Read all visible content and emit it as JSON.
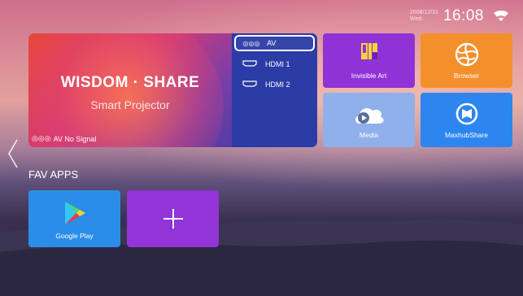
{
  "status": {
    "date": "2008/12/31",
    "weekday": "Wed.",
    "time": "16:08"
  },
  "hero": {
    "title": "WISDOM · SHARE",
    "subtitle": "Smart Projector",
    "signal_text": "AV No Signal"
  },
  "sources": [
    {
      "label": "AV",
      "icon": "av-connector-icon",
      "selected": true
    },
    {
      "label": "HDMI 1",
      "icon": "hdmi-port-icon",
      "selected": false
    },
    {
      "label": "HDMI 2",
      "icon": "hdmi-port-icon",
      "selected": false
    }
  ],
  "tiles": [
    {
      "label": "Invisible Art",
      "color": "#8f33d6",
      "icon": "invisible-art-icon"
    },
    {
      "label": "Browser",
      "color": "#f4902c",
      "icon": "browser-icon"
    },
    {
      "label": "Media",
      "color": "#8fb0ea",
      "icon": "media-cloud-play-icon"
    },
    {
      "label": "MaxhubShare",
      "color": "#2d86f0",
      "icon": "maxhubshare-icon"
    }
  ],
  "fav": {
    "heading": "FAV APPS",
    "apps": [
      {
        "label": "Google Play",
        "color": "#2a8ee8",
        "icon": "google-play-icon"
      }
    ],
    "add_color": "#9234d8",
    "add_icon": "plus-icon"
  }
}
